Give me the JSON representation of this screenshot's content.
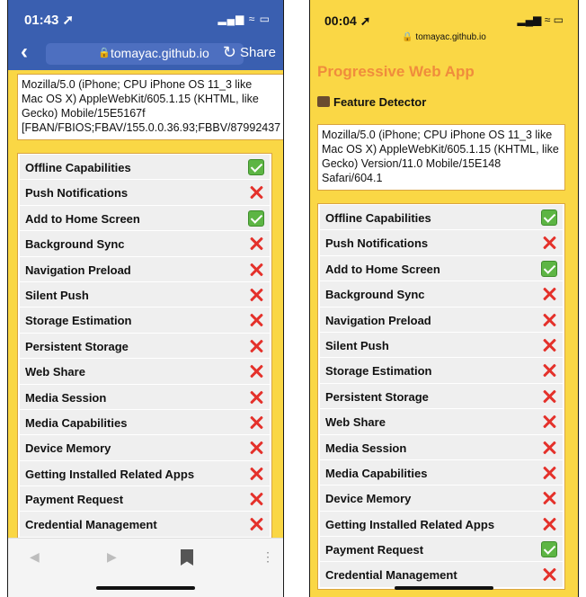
{
  "left_phone": {
    "status": {
      "time": "01:43 ➚",
      "indicators": "▂▄▆ ≈ ▭"
    },
    "nav": {
      "back_icon": "chevron-left-icon",
      "lock_icon": "lock-icon",
      "url": "tomayac.github.io",
      "reload_icon": "reload-icon",
      "share": "Share"
    },
    "user_agent_lines": [
      "Mozilla/5.0 (iPhone; CPU iPhone OS 11_3 like",
      "Mac OS X) AppleWebKit/605.1.15 (KHTML, like",
      "Gecko) Mobile/15E5167f",
      "[FBAN/FBIOS;FBAV/155.0.0.36.93;FBBV/87992437"
    ],
    "features": [
      {
        "label": "Offline Capabilities",
        "supported": true
      },
      {
        "label": "Push Notifications",
        "supported": false
      },
      {
        "label": "Add to Home Screen",
        "supported": true
      },
      {
        "label": "Background Sync",
        "supported": false
      },
      {
        "label": "Navigation Preload",
        "supported": false
      },
      {
        "label": "Silent Push",
        "supported": false
      },
      {
        "label": "Storage Estimation",
        "supported": false
      },
      {
        "label": "Persistent Storage",
        "supported": false
      },
      {
        "label": "Web Share",
        "supported": false
      },
      {
        "label": "Media Session",
        "supported": false
      },
      {
        "label": "Media Capabilities",
        "supported": false
      },
      {
        "label": "Device Memory",
        "supported": false
      },
      {
        "label": "Getting Installed Related Apps",
        "supported": false
      },
      {
        "label": "Payment Request",
        "supported": false
      },
      {
        "label": "Credential Management",
        "supported": false
      }
    ],
    "bottom_bar": {
      "back": "◀",
      "forward": "▶",
      "menu": "⋮"
    }
  },
  "right_phone": {
    "status": {
      "time": "00:04 ➚",
      "indicators": "▂▄▆ ≈ ▭",
      "url": "🔒 tomayac.github.io"
    },
    "title": "Progressive Web App",
    "subtitle": "Feature Detector",
    "user_agent": "Mozilla/5.0 (iPhone; CPU iPhone OS 11_3 like Mac OS X) AppleWebKit/605.1.15 (KHTML, like Gecko) Version/11.0 Mobile/15E148 Safari/604.1",
    "features": [
      {
        "label": "Offline Capabilities",
        "supported": true
      },
      {
        "label": "Push Notifications",
        "supported": false
      },
      {
        "label": "Add to Home Screen",
        "supported": true
      },
      {
        "label": "Background Sync",
        "supported": false
      },
      {
        "label": "Navigation Preload",
        "supported": false
      },
      {
        "label": "Silent Push",
        "supported": false
      },
      {
        "label": "Storage Estimation",
        "supported": false
      },
      {
        "label": "Persistent Storage",
        "supported": false
      },
      {
        "label": "Web Share",
        "supported": false
      },
      {
        "label": "Media Session",
        "supported": false
      },
      {
        "label": "Media Capabilities",
        "supported": false
      },
      {
        "label": "Device Memory",
        "supported": false
      },
      {
        "label": "Getting Installed Related Apps",
        "supported": false
      },
      {
        "label": "Payment Request",
        "supported": true
      },
      {
        "label": "Credential Management",
        "supported": false
      }
    ]
  },
  "colors": {
    "page_bg": "#fad745",
    "title": "#f08c3c",
    "fb_bar": "#3a5fb0",
    "check": "#5db544",
    "cross": "#e4312b"
  }
}
